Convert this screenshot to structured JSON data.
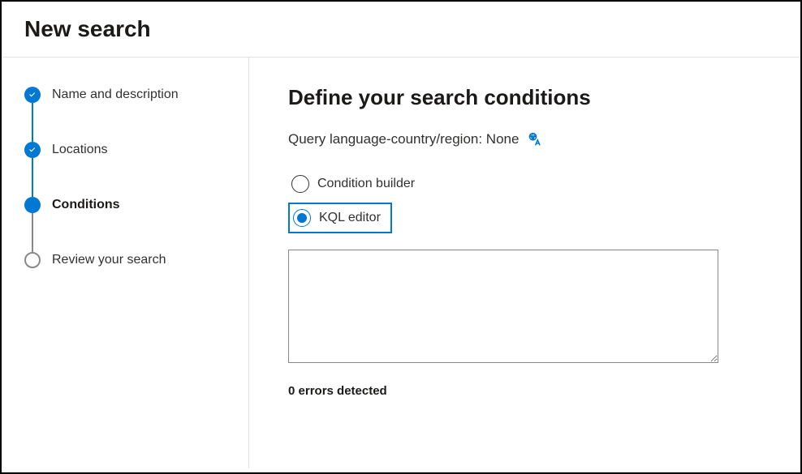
{
  "header": {
    "title": "New search"
  },
  "sidebar": {
    "steps": [
      {
        "label": "Name and description",
        "state": "completed"
      },
      {
        "label": "Locations",
        "state": "completed"
      },
      {
        "label": "Conditions",
        "state": "current"
      },
      {
        "label": "Review your search",
        "state": "upcoming"
      }
    ]
  },
  "main": {
    "heading": "Define your search conditions",
    "language_label": "Query language-country/region: None",
    "radios": {
      "condition_builder": "Condition builder",
      "kql_editor": "KQL editor",
      "selected": "kql_editor"
    },
    "editor_value": "",
    "errors_text": "0 errors detected"
  },
  "colors": {
    "accent": "#0078d4"
  }
}
